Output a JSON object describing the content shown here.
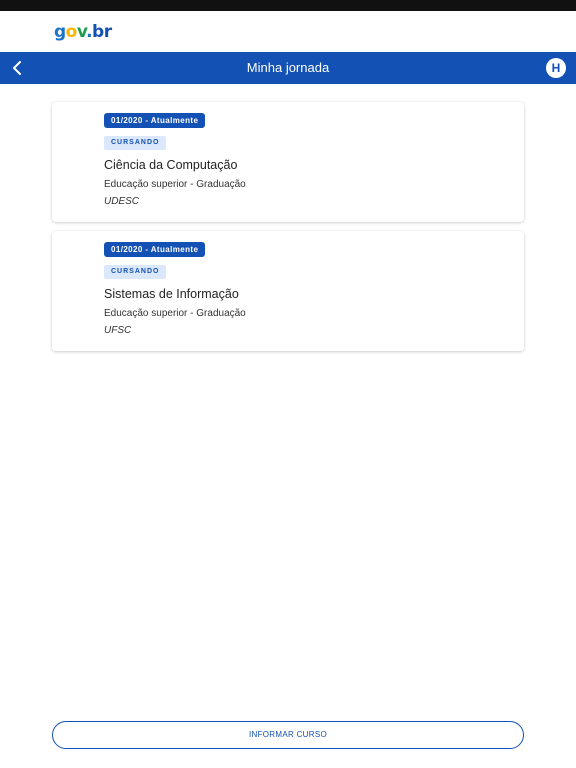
{
  "brand": {
    "logo_g": "g",
    "logo_o": "o",
    "logo_v": "v",
    "logo_dot": ".",
    "logo_b": "b",
    "logo_r": "r"
  },
  "header": {
    "title": "Minha jornada",
    "avatar_initial": "H"
  },
  "courses": [
    {
      "period": "01/2020 - Atualmente",
      "status": "CURSANDO",
      "name": "Ciência da Computação",
      "level": "Educação superior - Graduação",
      "institution": "UDESC"
    },
    {
      "period": "01/2020 - Atualmente",
      "status": "CURSANDO",
      "name": "Sistemas de Informação",
      "level": "Educação superior - Graduação",
      "institution": "UFSC"
    }
  ],
  "footer": {
    "action_label": "INFORMAR CURSO"
  },
  "colors": {
    "primary": "#1351b4",
    "status_badge_bg": "#dbe8fb",
    "status_bar": "#111111"
  },
  "icons": {
    "back": "chevron-left-icon"
  }
}
